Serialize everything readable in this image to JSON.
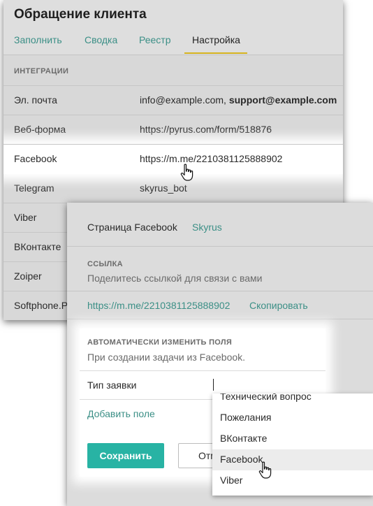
{
  "panel1": {
    "title": "Обращение клиента",
    "tabs": [
      "Заполнить",
      "Сводка",
      "Реестр",
      "Настройка"
    ],
    "active_tab": "Настройка",
    "section_caption": "ИНТЕГРАЦИИ",
    "rows": [
      {
        "label": "Эл. почта",
        "value": "info@example.com, ",
        "value_bold": "support@example.com"
      },
      {
        "label": "Веб-форма",
        "value": "https://pyrus.com/form/518876"
      },
      {
        "label": "Facebook",
        "value": "https://m.me/2210381125888902"
      },
      {
        "label": "Telegram",
        "value": "skyrus_bot"
      },
      {
        "label": "Viber"
      },
      {
        "label": "ВКонтакте"
      },
      {
        "label": "Zoiper"
      },
      {
        "label": "Softphone.Pro"
      }
    ]
  },
  "panel2": {
    "page_label": "Страница Facebook",
    "page_value": "Skyrus",
    "link_caption": "ССЫЛКА",
    "link_sub": "Поделитесь ссылкой для связи с вами",
    "link_url": "https://m.me/2210381125888902",
    "copy_label": "Скопировать",
    "auto_caption": "АВТОМАТИЧЕСКИ ИЗМЕНИТЬ ПОЛЯ",
    "auto_sub": "При создании задачи из Facebook.",
    "field_label": "Тип заявки",
    "add_field": "Добавить поле",
    "save_label": "Сохранить",
    "cancel_label": "Отмена"
  },
  "dropdown": {
    "items": [
      "Технический вопрос",
      "Пожелания",
      "ВКонтакте",
      "Facebook",
      "Viber"
    ],
    "hovered": "Facebook"
  },
  "colors": {
    "accent_link": "#3b8f86",
    "tab_underline": "#d6b31f",
    "save_button": "#28b3a4"
  },
  "icons": {
    "cursor": "hand-pointer-icon"
  }
}
